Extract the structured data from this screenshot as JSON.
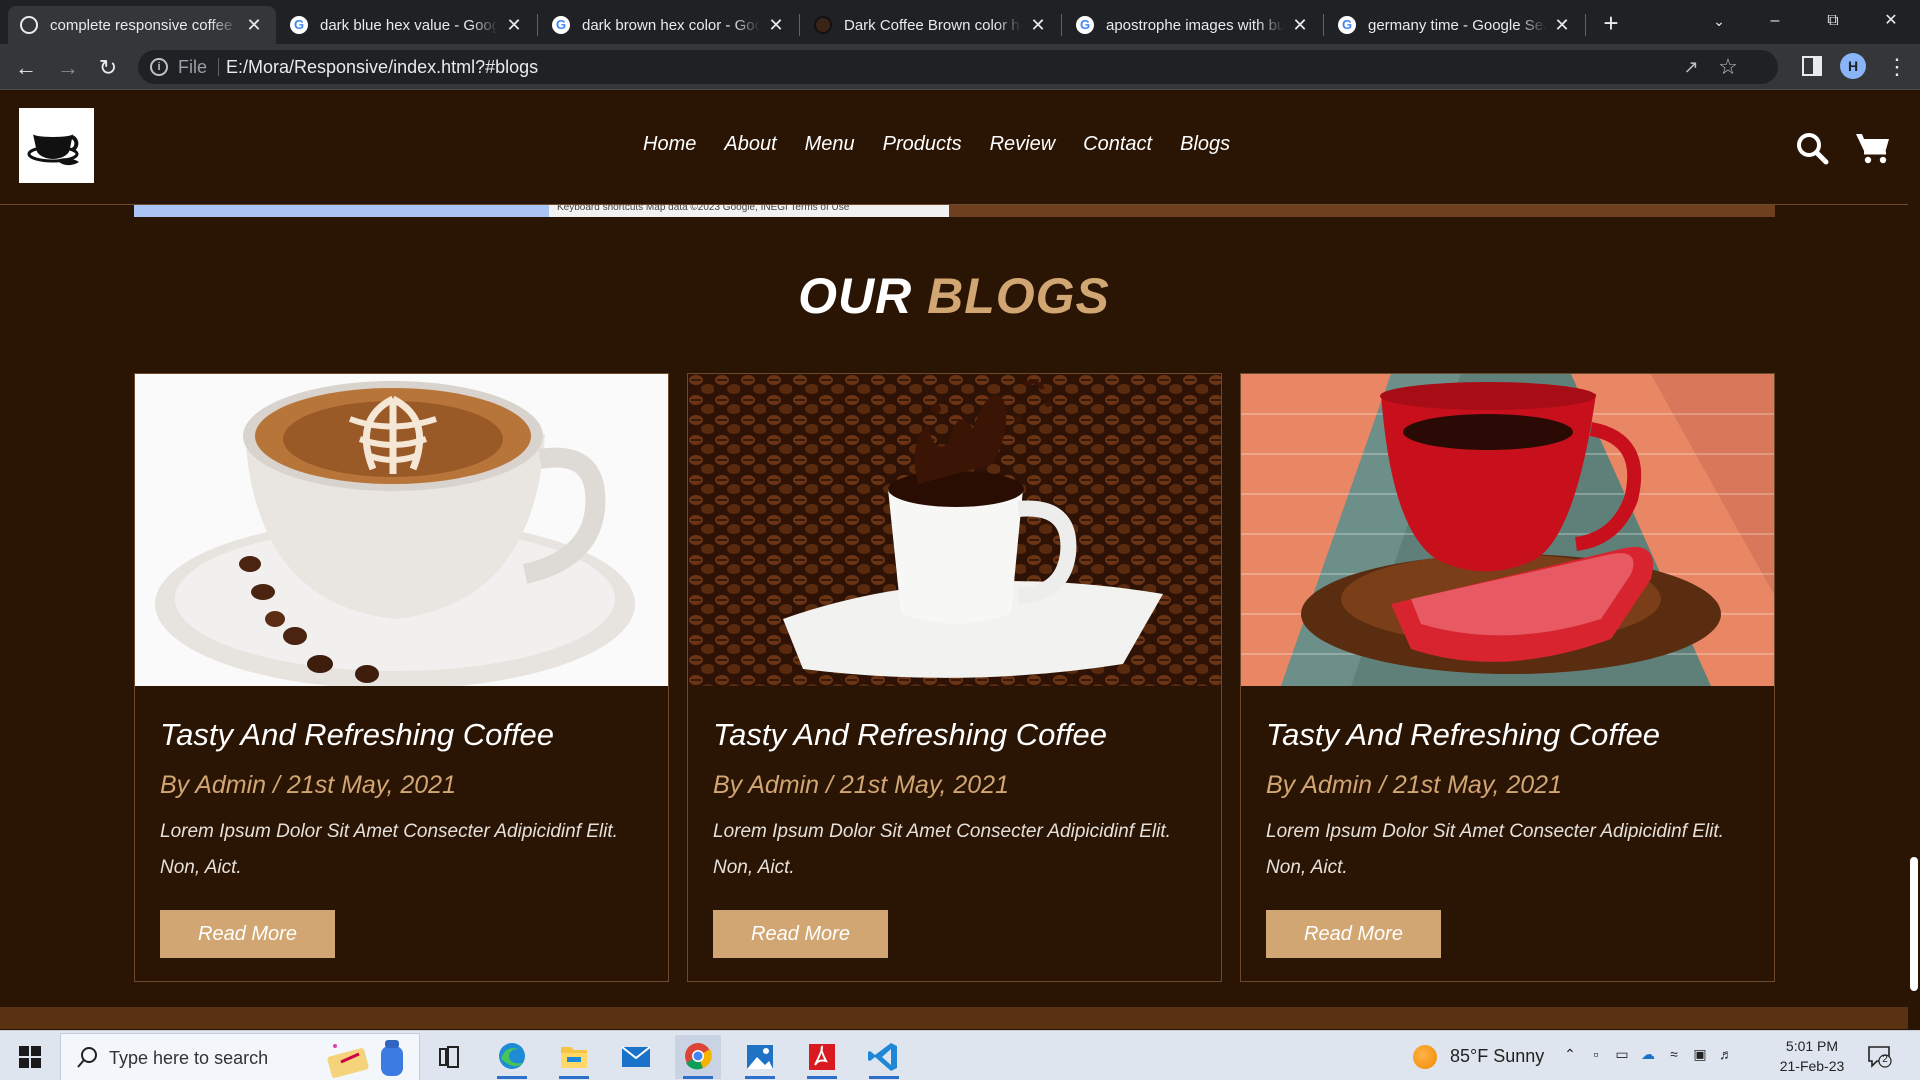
{
  "browser": {
    "tabs": [
      {
        "title": "complete responsive coffee",
        "favicon": "globe-icon",
        "active": true
      },
      {
        "title": "dark blue hex value - Google",
        "favicon": "google-icon",
        "active": false
      },
      {
        "title": "dark brown hex color - Goo",
        "favicon": "google-icon",
        "active": false
      },
      {
        "title": "Dark Coffee Brown color he",
        "favicon": "color-swatch-icon",
        "active": false
      },
      {
        "title": "apostrophe images with bu",
        "favicon": "google-icon",
        "active": false
      },
      {
        "title": "germany time - Google Sea",
        "favicon": "google-icon",
        "active": false
      }
    ],
    "close_glyph": "✕",
    "new_tab_glyph": "+",
    "address": {
      "scheme_label": "File",
      "url": "E:/Mora/Responsive/index.html?#blogs"
    },
    "profile_initial": "H"
  },
  "site": {
    "nav": [
      "Home",
      "About",
      "Menu",
      "Products",
      "Review",
      "Contact",
      "Blogs"
    ],
    "map_attribution": "Keyboard shortcuts   Map data ©2023 Google, INEGI   Terms of Use",
    "section_title_white": "OUR",
    "section_title_accent": "BLOGS",
    "blogs": [
      {
        "title": "Tasty And Refreshing Coffee",
        "meta": "By Admin / 21st May, 2021",
        "text": "Lorem Ipsum Dolor Sit Amet Consecter Adipicidinf Elit. Non, Aict.",
        "button": "Read More",
        "image": "latte-art-cup"
      },
      {
        "title": "Tasty And Refreshing Coffee",
        "meta": "By Admin / 21st May, 2021",
        "text": "Lorem Ipsum Dolor Sit Amet Consecter Adipicidinf Elit. Non, Aict.",
        "button": "Read More",
        "image": "splashing-coffee-cup"
      },
      {
        "title": "Tasty And Refreshing Coffee",
        "meta": "By Admin / 21st May, 2021",
        "text": "Lorem Ipsum Dolor Sit Amet Consecter Adipicidinf Elit. Non, Aict.",
        "button": "Read More",
        "image": "red-cup-striped-mat"
      }
    ],
    "colors": {
      "background": "#2a1404",
      "accent": "#d1a672"
    }
  },
  "taskbar": {
    "search_placeholder": "Type here to search",
    "weather": "85°F  Sunny",
    "time": "5:01 PM",
    "date": "21-Feb-23",
    "notification_count": "2"
  }
}
